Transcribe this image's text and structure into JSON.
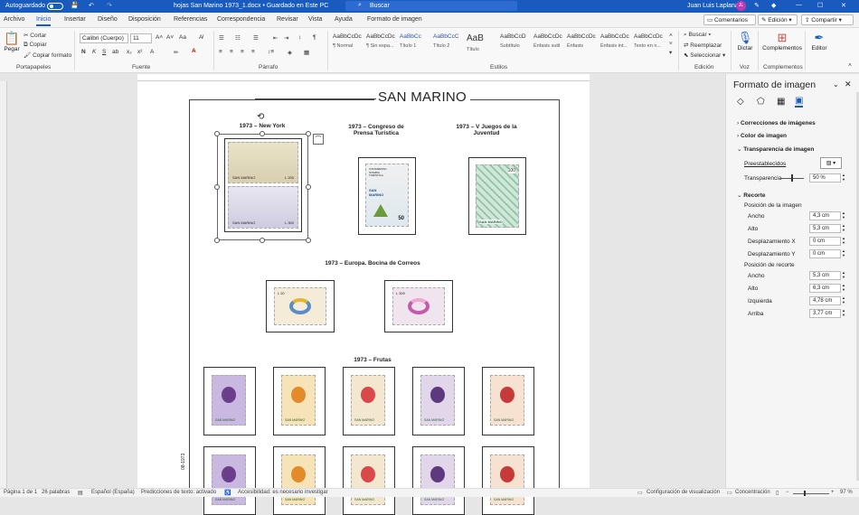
{
  "titlebar": {
    "autosave_label": "Autoguardado",
    "doc_title": "hojas San Marino 1973_1.docx • Guardado en Este PC",
    "search_placeholder": "Buscar",
    "user_name": "Juan Luis Laplana",
    "user_initials": "JL"
  },
  "tabs": [
    "Archivo",
    "Inicio",
    "Insertar",
    "Diseño",
    "Disposición",
    "Referencias",
    "Correspondencia",
    "Revisar",
    "Vista",
    "Ayuda",
    "Formato de imagen"
  ],
  "active_tab": "Inicio",
  "ribbon_right": {
    "comments": "Comentarios",
    "editing": "Edición",
    "share": "Compartir"
  },
  "ribbon": {
    "clipboard": {
      "paste": "Pegar",
      "cut": "Cortar",
      "copy": "Copiar",
      "format_painter": "Copiar formato",
      "label": "Portapapeles"
    },
    "font": {
      "family": "Calibri (Cuerpo)",
      "size": "11",
      "label": "Fuente"
    },
    "paragraph": {
      "label": "Párrafo"
    },
    "styles": {
      "label": "Estilos",
      "items": [
        {
          "sample": "AaBbCcDc",
          "name": "¶ Normal"
        },
        {
          "sample": "AaBbCcDc",
          "name": "¶ Sin espa..."
        },
        {
          "sample": "AaBbCc",
          "name": "Título 1"
        },
        {
          "sample": "AaBbCcC",
          "name": "Título 2"
        },
        {
          "sample": "AaB",
          "name": "Título"
        },
        {
          "sample": "AaBbCcD",
          "name": "Subtítulo"
        },
        {
          "sample": "AaBbCcDc",
          "name": "Énfasis sutil"
        },
        {
          "sample": "AaBbCcDc",
          "name": "Énfasis"
        },
        {
          "sample": "AaBbCcDc",
          "name": "Énfasis int..."
        },
        {
          "sample": "AaBbCcDc",
          "name": "Texto en n..."
        }
      ]
    },
    "editing": {
      "find": "Buscar",
      "replace": "Reemplazar",
      "select": "Seleccionar",
      "label": "Edición"
    },
    "voice": {
      "dictate": "Dictar",
      "label": "Voz"
    },
    "addins": {
      "addins": "Complementos",
      "label": "Complementos"
    },
    "editor": {
      "editor": "Editor"
    }
  },
  "document": {
    "title": "SAN MARINO",
    "captions": {
      "newyork": "1973 – New York",
      "congreso": "1973 – Congreso de Prensa Turística",
      "juegos": "1973 – V Juegos de la Juventud",
      "europa": "1973 – Europa. Bocina de Correos",
      "frutas": "1973 – Frutas"
    },
    "stamp_texts": {
      "sanmarino": "SAN MARINO",
      "ny_value_1": "L 200",
      "ny_value_2": "L 300",
      "congreso_value": "50",
      "congreso_text": "CONGRESSO STAMPA TURISTICA",
      "juegos_value": "100",
      "europa_value_1": "L 20",
      "europa_value_2": "L 300"
    },
    "margin_code": "08-1973"
  },
  "pane": {
    "title": "Formato de imagen",
    "sections": {
      "corrections": "Correcciones de imágenes",
      "color": "Color de imagen",
      "transparency": "Transparencia de imagen",
      "crop": "Recorte"
    },
    "presets_label": "Preestablecidos",
    "transparency_label": "Transparencia",
    "transparency_value": "50 %",
    "image_position_label": "Posición de la imagen",
    "crop_position_label": "Posición de recorte",
    "image_position": [
      {
        "label": "Ancho",
        "value": "4,3 cm"
      },
      {
        "label": "Alto",
        "value": "5,3 cm"
      },
      {
        "label": "Desplazamiento X",
        "value": "0 cm"
      },
      {
        "label": "Desplazamiento Y",
        "value": "0 cm"
      }
    ],
    "crop_position": [
      {
        "label": "Ancho",
        "value": "5,3 cm"
      },
      {
        "label": "Alto",
        "value": "6,3 cm"
      },
      {
        "label": "Izquierda",
        "value": "4,78 cm"
      },
      {
        "label": "Arriba",
        "value": "3,77 cm"
      }
    ]
  },
  "statusbar": {
    "page": "Página 1 de 1",
    "words": "26 palabras",
    "language": "Español (España)",
    "predictions": "Predicciones de texto: activado",
    "accessibility": "Accesibilidad: es necesario investigar",
    "display_settings": "Configuración de visualización",
    "focus": "Concentración",
    "zoom": "97 %"
  },
  "colors": {
    "accent": "#185abd",
    "ribbon_bg": "#f8f8f8"
  }
}
